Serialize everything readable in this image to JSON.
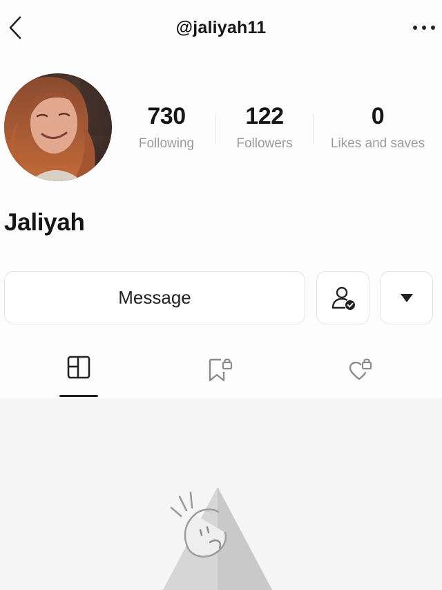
{
  "header": {
    "handle": "@jaliyah11",
    "back_icon": "chevron-left-icon",
    "more_icon": "more-horizontal-icon"
  },
  "profile": {
    "name": "Jaliyah",
    "avatar_icon": "avatar"
  },
  "stats": [
    {
      "value": "730",
      "label": "Following"
    },
    {
      "value": "122",
      "label": "Followers"
    },
    {
      "value": "0",
      "label": "Likes and saves"
    }
  ],
  "actions": {
    "message_label": "Message",
    "follow_icon": "user-check-icon",
    "dropdown_icon": "triangle-down-icon"
  },
  "tabs": [
    {
      "icon": "grid-layout-icon",
      "active": true
    },
    {
      "icon": "bookmark-lock-icon",
      "active": false
    },
    {
      "icon": "heart-lock-icon",
      "active": false
    }
  ],
  "colors": {
    "text": "#161616",
    "muted": "#9b9b9b",
    "border": "#e3e3e3",
    "content_bg": "#f5f5f5"
  }
}
